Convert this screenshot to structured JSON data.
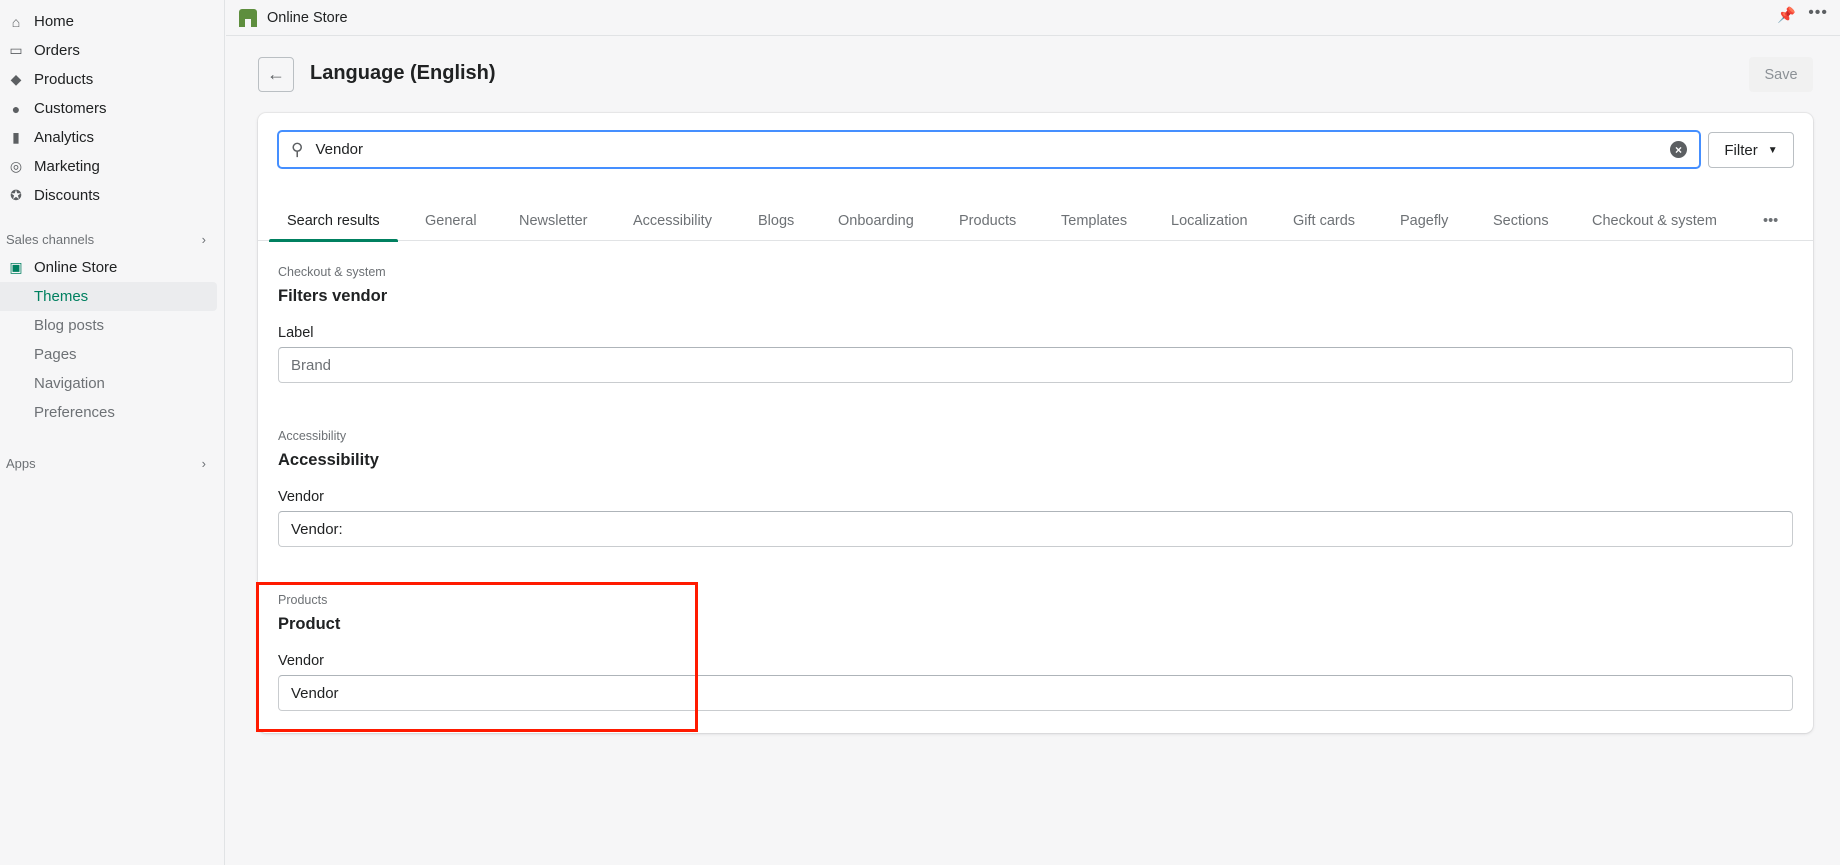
{
  "sidebar": {
    "items": [
      {
        "label": "Home",
        "icon": "home-icon"
      },
      {
        "label": "Orders",
        "icon": "orders-icon"
      },
      {
        "label": "Products",
        "icon": "tag-icon"
      },
      {
        "label": "Customers",
        "icon": "person-icon"
      },
      {
        "label": "Analytics",
        "icon": "bar-chart-icon"
      },
      {
        "label": "Marketing",
        "icon": "target-icon"
      },
      {
        "label": "Discounts",
        "icon": "discount-icon"
      }
    ],
    "sales_channels": "Sales channels",
    "online_store": "Online Store",
    "sub_items": [
      "Themes",
      "Blog posts",
      "Pages",
      "Navigation",
      "Preferences"
    ],
    "apps": "Apps"
  },
  "topbar": {
    "title": "Online Store"
  },
  "header": {
    "title": "Language (English)",
    "save": "Save"
  },
  "search": {
    "value": "Vendor",
    "filter": "Filter"
  },
  "tabs": [
    "Search results",
    "General",
    "Newsletter",
    "Accessibility",
    "Blogs",
    "Onboarding",
    "Products",
    "Templates",
    "Localization",
    "Gift cards",
    "Pagefly",
    "Sections",
    "Checkout & system"
  ],
  "groups": [
    {
      "category": "Checkout & system",
      "heading": "Filters vendor",
      "label": "Label",
      "value": "",
      "placeholder": "Brand"
    },
    {
      "category": "Accessibility",
      "heading": "Accessibility",
      "label": "Vendor",
      "value": "Vendor:",
      "placeholder": ""
    },
    {
      "category": "Products",
      "heading": "Product",
      "label": "Vendor",
      "value": "Vendor",
      "placeholder": ""
    }
  ],
  "colors": {
    "accent": "#008060",
    "focus": "#458fff",
    "highlight": "#ff1a00"
  }
}
